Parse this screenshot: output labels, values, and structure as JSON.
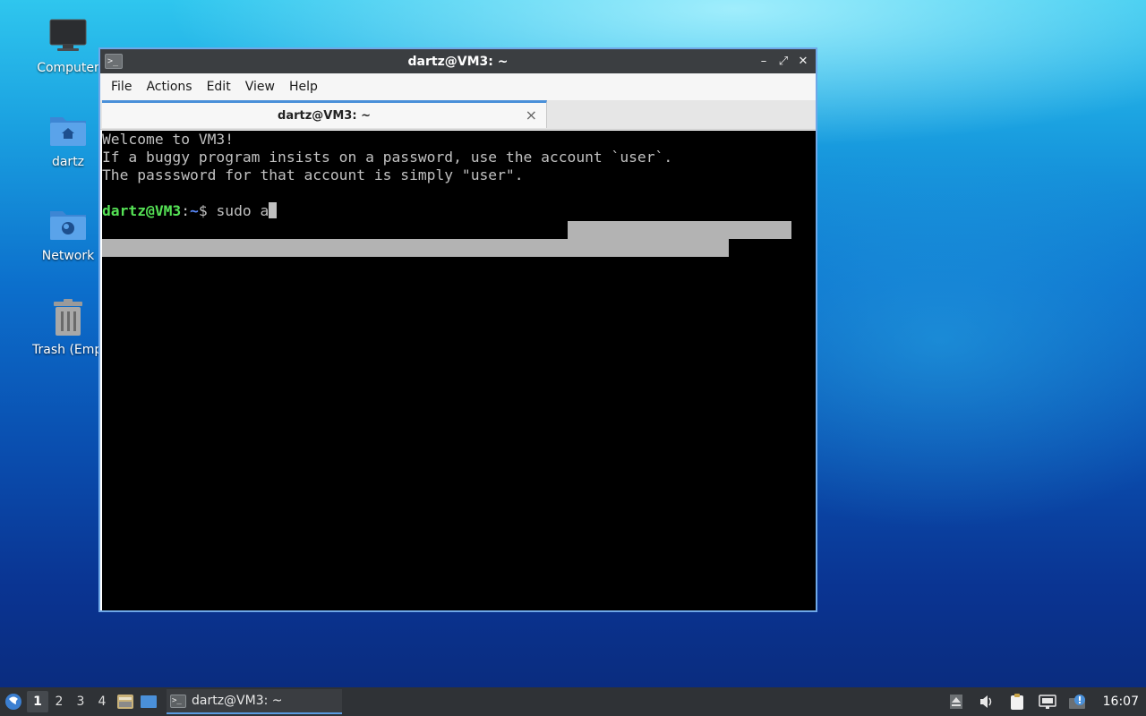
{
  "desktop": {
    "icons": [
      {
        "label": "Computer",
        "icon": "computer-icon"
      },
      {
        "label": "dartz",
        "icon": "home-folder-icon"
      },
      {
        "label": "Network",
        "icon": "network-folder-icon"
      },
      {
        "label": "Trash (Empty)",
        "icon": "trash-icon"
      }
    ]
  },
  "window": {
    "title": "dartz@VM3: ~",
    "menu": [
      "File",
      "Actions",
      "Edit",
      "View",
      "Help"
    ],
    "tab_label": "dartz@VM3: ~",
    "tab_close": "×",
    "controls": {
      "minimize": "–",
      "maximize": "⤢",
      "close": "✕"
    }
  },
  "terminal": {
    "lines": [
      "Welcome to VM3!",
      "If a buggy program insists on a password, use the account `user`.",
      "The passsword for that account is simply \"user\".",
      ""
    ],
    "prompt_user": "dartz@VM3",
    "prompt_sep": ":",
    "prompt_path": "~",
    "prompt_symbol": "$ ",
    "command": "sudo a"
  },
  "taskbar": {
    "workspaces": [
      "1",
      "2",
      "3",
      "4"
    ],
    "active_workspace": "1",
    "task_label": "dartz@VM3: ~",
    "clock": "16:07"
  },
  "colors": {
    "accent": "#4a90d9",
    "prompt_user": "#55e255",
    "prompt_path": "#5b8cff"
  }
}
